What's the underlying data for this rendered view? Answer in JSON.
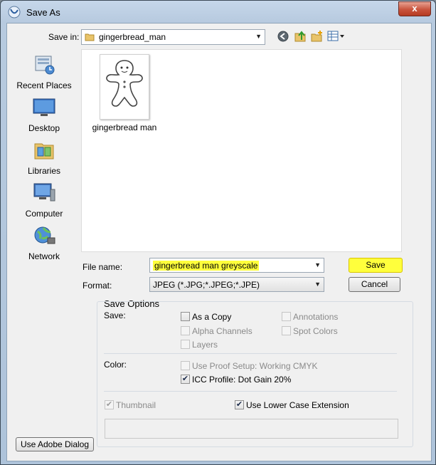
{
  "window": {
    "title": "Save As",
    "close_glyph": "x"
  },
  "save_in": {
    "label": "Save in:",
    "value": "gingerbread_man"
  },
  "toolbar": {
    "icons": [
      "back-icon",
      "up-folder-icon",
      "new-folder-icon",
      "view-menu-icon"
    ]
  },
  "places": [
    {
      "label": "Recent Places",
      "icon": "recent-places-icon"
    },
    {
      "label": "Desktop",
      "icon": "desktop-icon"
    },
    {
      "label": "Libraries",
      "icon": "libraries-icon"
    },
    {
      "label": "Computer",
      "icon": "computer-icon"
    },
    {
      "label": "Network",
      "icon": "network-icon"
    }
  ],
  "files": [
    {
      "name": "gingerbread man"
    }
  ],
  "file_name": {
    "label": "File name:",
    "value": "gingerbread man greyscale"
  },
  "format": {
    "label": "Format:",
    "value": "JPEG (*.JPG;*.JPEG;*.JPE)"
  },
  "buttons": {
    "save": "Save",
    "cancel": "Cancel",
    "adobe_dialog": "Use Adobe Dialog"
  },
  "save_options": {
    "title": "Save Options",
    "save_label": "Save:",
    "as_a_copy": {
      "label": "As a Copy",
      "checked": false,
      "enabled": true
    },
    "annotations": {
      "label": "Annotations",
      "checked": false,
      "enabled": false
    },
    "alpha_channels": {
      "label": "Alpha Channels",
      "checked": false,
      "enabled": false
    },
    "spot_colors": {
      "label": "Spot Colors",
      "checked": false,
      "enabled": false
    },
    "layers": {
      "label": "Layers",
      "checked": false,
      "enabled": false
    },
    "color_label": "Color:",
    "use_proof_setup": {
      "label": "Use Proof Setup:  Working CMYK",
      "checked": false,
      "enabled": false
    },
    "icc_profile": {
      "label": "ICC Profile:  Dot Gain 20%",
      "checked": true,
      "enabled": true
    },
    "thumbnail": {
      "label": "Thumbnail",
      "checked": true,
      "enabled": false
    },
    "lower_case_ext": {
      "label": "Use Lower Case Extension",
      "checked": true,
      "enabled": true
    }
  },
  "colors": {
    "highlight": "#ffff3c",
    "title_bar": "#b7cadf",
    "close_button": "#c9543d"
  }
}
